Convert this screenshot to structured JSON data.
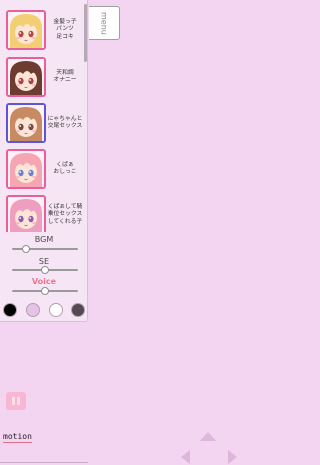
{
  "theme": {
    "background": "#f3d4f1",
    "panel": "#f6e5f4",
    "frame": "#e8609a",
    "frame_selected": "#5c56d6",
    "voice_text": "#f26d8e",
    "arrow": "#ddb6db"
  },
  "menu_tab": {
    "label": "menu"
  },
  "scenes": [
    {
      "label": "金髪っ子\nパンツ\n足コキ",
      "hair_color": "#f2cf72",
      "eye_color": "#b9473f",
      "selected": false
    },
    {
      "label": "天和調\nオナニー",
      "hair_color": "#6e3b30",
      "eye_color": "#b04040",
      "selected": false
    },
    {
      "label": "にゃちゃんと\n交尾セックス",
      "hair_color": "#c88a62",
      "eye_color": "#7a4a3a",
      "selected": true
    },
    {
      "label": "くぱぁ\nおしっこ",
      "hair_color": "#f5a6b2",
      "eye_color": "#6a80d0",
      "selected": false
    },
    {
      "label": "くぱぁして騎\n乗位セックス\nしてくれる子",
      "hair_color": "#f09ec0",
      "eye_color": "#8c5ab0",
      "selected": false
    }
  ],
  "audio": {
    "bgm": {
      "label": "BGM",
      "level": 0.18
    },
    "se": {
      "label": "SE",
      "level": 0.5
    },
    "voice": {
      "label": "Voice",
      "level": 0.5
    }
  },
  "swatches": [
    "#000000",
    "#e5c3e4",
    "#ffffff",
    "#554a51"
  ],
  "motion": {
    "label": "motion"
  },
  "icons": {
    "pause": "pause-icon",
    "up": "up-arrow-icon",
    "left": "left-arrow-icon",
    "right": "right-arrow-icon"
  }
}
